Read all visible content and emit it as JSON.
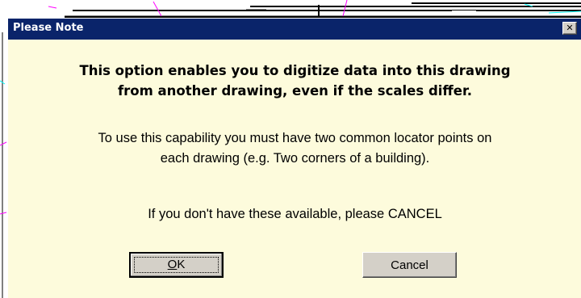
{
  "dialog": {
    "title": "Please Note",
    "close_glyph": "✕",
    "message_bold": [
      "This option enables you to digitize data into this drawing",
      "from another drawing, even if the scales differ."
    ],
    "message_normal": [
      "To use this capability you must have two common locator points on",
      "each drawing (e.g. Two corners of a building)."
    ],
    "message_cancel": "If you don't have these available, please CANCEL",
    "ok_mnemonic": "O",
    "ok_rest": "K",
    "cancel_label": "Cancel"
  },
  "colors": {
    "titlebar": "#0a246a",
    "dialog_background": "#fdfbdc",
    "button_face": "#d4d0c8"
  }
}
